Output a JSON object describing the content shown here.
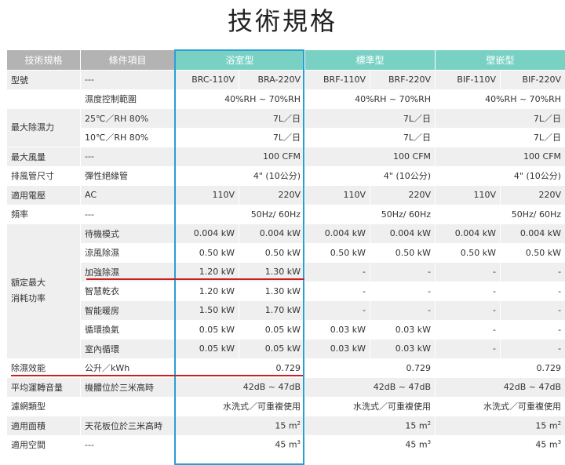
{
  "title": "技術規格",
  "headers": {
    "spec": "技術規格",
    "condition": "條件項目",
    "bath": "浴室型",
    "standard": "標準型",
    "wall": "壁嵌型"
  },
  "rows": {
    "model": {
      "label": "型號",
      "cond": "---",
      "v": [
        "BRC-110V",
        "BRA-220V",
        "BRF-110V",
        "BRF-220V",
        "BIF-110V",
        "BIF-220V"
      ]
    },
    "humidity": {
      "cond": "濕度控制範圍",
      "bath": "40%RH ~ 70%RH",
      "standard": "40%RH ~ 70%RH",
      "wall": "40%RH ~ 70%RH"
    },
    "dehum_label": "最大除濕力",
    "dehum25": {
      "cond": "25℃／RH 80%",
      "bath": "7L／日",
      "standard": "7L／日",
      "wall": "7L／日"
    },
    "dehum10": {
      "cond": "10℃／RH 80%",
      "bath": "7L／日",
      "standard": "7L／日",
      "wall": "7L／日"
    },
    "airflow": {
      "label": "最大風量",
      "cond": "---",
      "bath": "100 CFM",
      "standard": "100 CFM",
      "wall": "100 CFM"
    },
    "duct": {
      "label": "排風管尺寸",
      "cond": "彈性絕緣管",
      "bath": "4\" (10公分)",
      "standard": "4\" (10公分)",
      "wall": "4\" (10公分)"
    },
    "voltage": {
      "label": "適用電壓",
      "cond": "AC",
      "v": [
        "110V",
        "220V",
        "110V",
        "220V",
        "110V",
        "220V"
      ]
    },
    "freq": {
      "label": "頻率",
      "cond": "---",
      "bath": "50Hz/ 60Hz",
      "standard": "50Hz/ 60Hz",
      "wall": "50Hz/ 60Hz"
    },
    "power_label_1": "額定最大",
    "power_label_2": "消耗功率",
    "standby": {
      "cond": "待機模式",
      "v": [
        "0.004 kW",
        "0.004 kW",
        "0.004 kW",
        "0.004 kW",
        "0.004 kW",
        "0.004 kW"
      ]
    },
    "cool": {
      "cond": "涼風除濕",
      "v": [
        "0.50 kW",
        "0.50 kW",
        "0.50 kW",
        "0.50 kW",
        "0.50 kW",
        "0.50 kW"
      ]
    },
    "strong": {
      "cond": "加強除濕",
      "v": [
        "1.20 kW",
        "1.30 kW",
        "-",
        "-",
        "-",
        "-"
      ]
    },
    "dry": {
      "cond": "智慧乾衣",
      "v": [
        "1.20 kW",
        "1.30 kW",
        "-",
        "-",
        "-",
        "-"
      ]
    },
    "heat": {
      "cond": "智能暖房",
      "v": [
        "1.50 kW",
        "1.70 kW",
        "-",
        "-",
        "-",
        "-"
      ]
    },
    "vent": {
      "cond": "循環換氣",
      "v": [
        "0.05 kW",
        "0.05 kW",
        "0.03 kW",
        "0.03 kW",
        "-",
        "-"
      ]
    },
    "indoor": {
      "cond": "室內循環",
      "v": [
        "0.05 kW",
        "0.05 kW",
        "0.03 kW",
        "0.03 kW",
        "-",
        "-"
      ]
    },
    "efficiency": {
      "label": "除濕效能",
      "cond": "公升／kWh",
      "bath": "0.729",
      "standard": "0.729",
      "wall": "0.729"
    },
    "noise": {
      "label": "平均運轉音量",
      "cond": "機體位於三米高時",
      "bath": "42dB ~ 47dB",
      "standard": "42dB ~ 47dB",
      "wall": "42dB ~ 47dB"
    },
    "filter": {
      "label": "濾網類型",
      "cond": "",
      "bath": "水洗式／可重複使用",
      "standard": "水洗式／可重複使用",
      "wall": "水洗式／可重複使用"
    },
    "area": {
      "label": "適用面積",
      "cond": "天花板位於三米高時",
      "val": "15 m",
      "sup": "2"
    },
    "space": {
      "label": "適用空間",
      "cond": "---",
      "val": "45 m",
      "sup": "3"
    }
  },
  "colors": {
    "header_gray": "#b3b3b3",
    "header_teal": "#79d1c4",
    "highlight_blue": "#2a9fd6",
    "underline_red": "#cc1f1f"
  }
}
